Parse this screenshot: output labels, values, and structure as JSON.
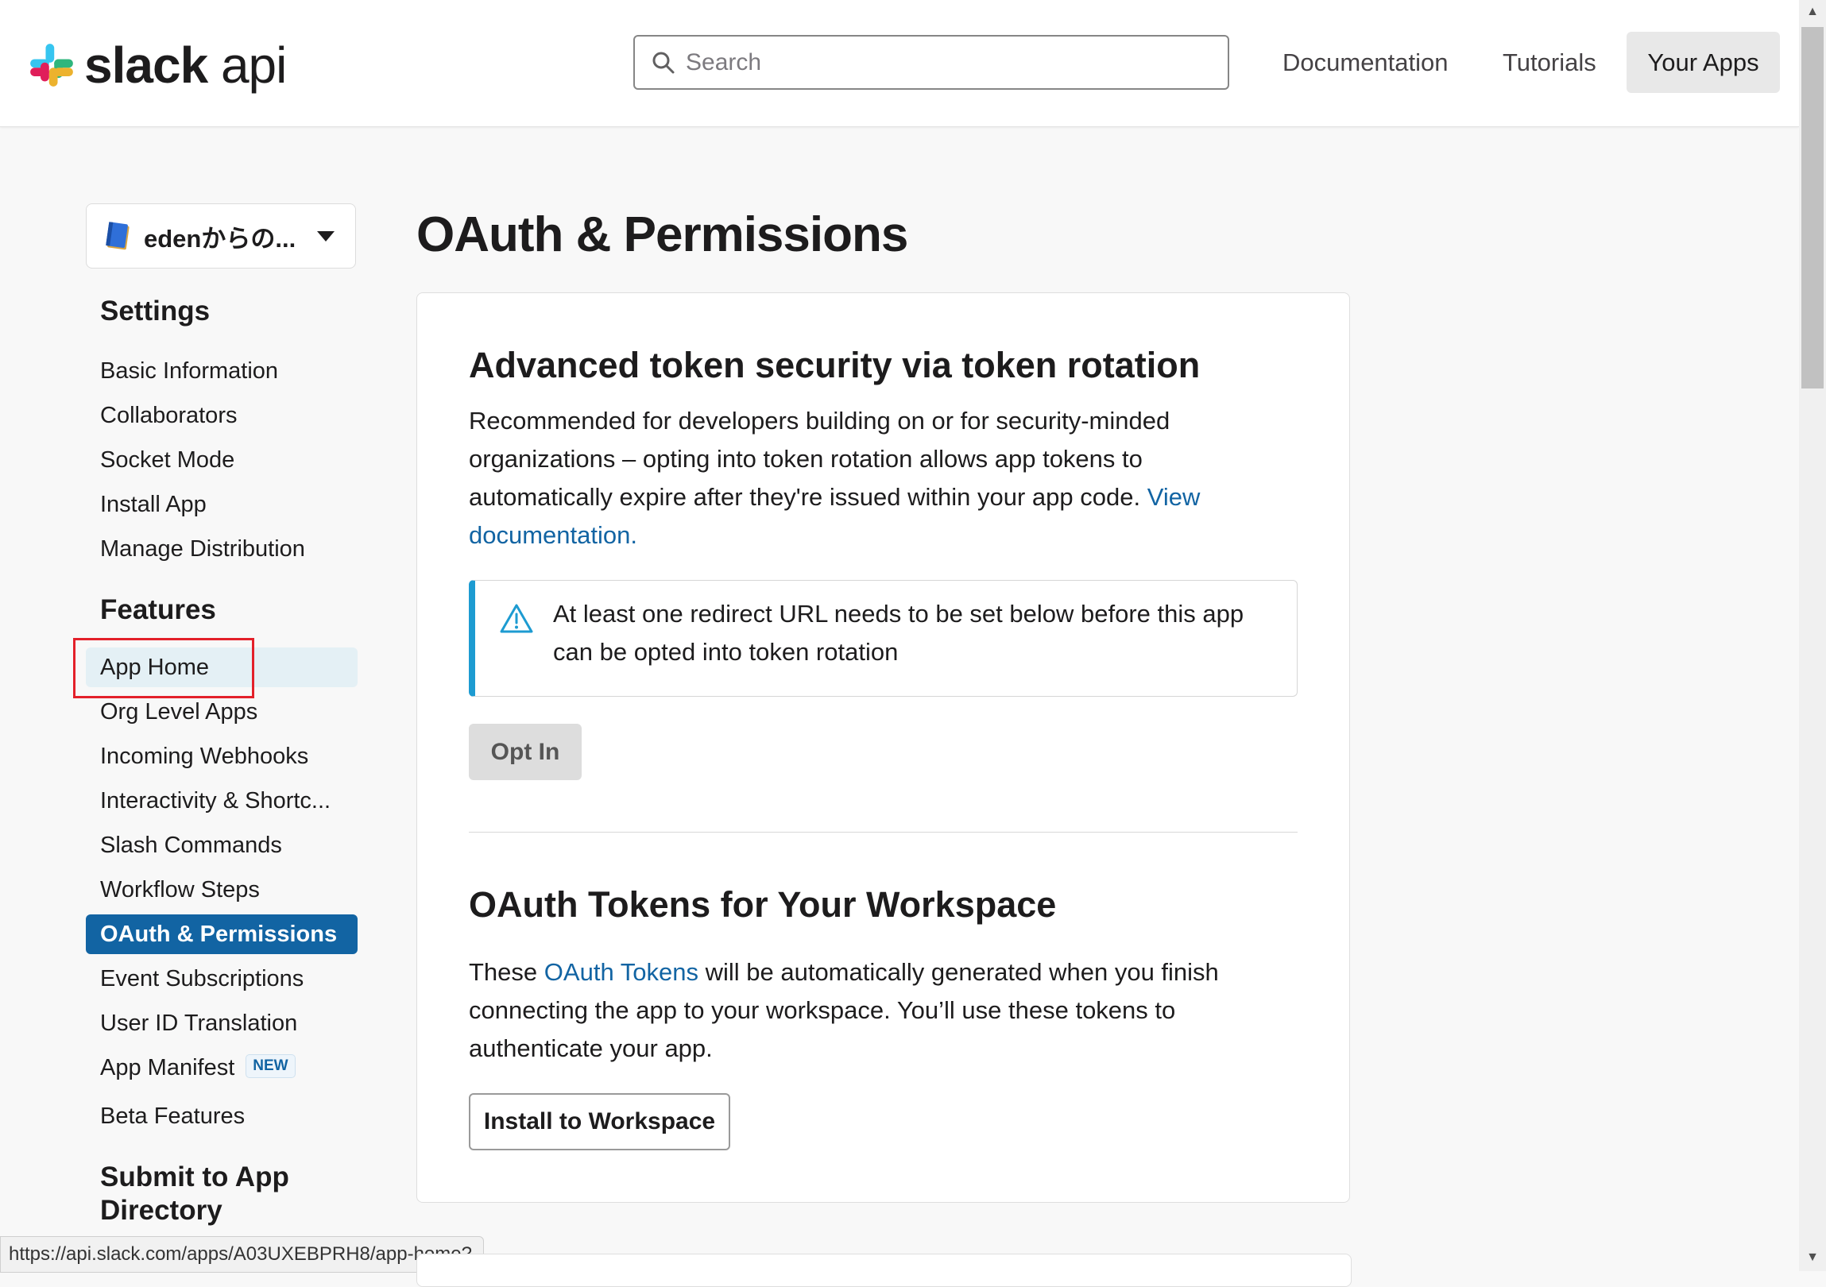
{
  "header": {
    "logo_bold": "slack",
    "logo_light": "api",
    "search_placeholder": "Search",
    "nav": [
      "Documentation",
      "Tutorials",
      "Your Apps"
    ]
  },
  "sidebar": {
    "app_name": "edenからの...",
    "settings_title": "Settings",
    "settings_items": [
      "Basic Information",
      "Collaborators",
      "Socket Mode",
      "Install App",
      "Manage Distribution"
    ],
    "features_title": "Features",
    "features_items": [
      "App Home",
      "Org Level Apps",
      "Incoming Webhooks",
      "Interactivity & Shortc...",
      "Slash Commands",
      "Workflow Steps",
      "OAuth & Permissions",
      "Event Subscriptions",
      "User ID Translation",
      "App Manifest",
      "Beta Features"
    ],
    "new_badge": "NEW",
    "submit_title_line1": "Submit to App",
    "submit_title_line2": "Directory",
    "status_url": "https://api.slack.com/apps/A03UXEBPRH8/app-home?"
  },
  "main": {
    "page_title": "OAuth & Permissions",
    "token_rotation": {
      "title": "Advanced token security via token rotation",
      "description": "Recommended for developers building on or for security-minded organizations – opting into token rotation allows app tokens to automatically expire after they're issued within your app code.",
      "link": "View documentation.",
      "alert": "At least one redirect URL needs to be set below before this app can be opted into token rotation",
      "button": "Opt In"
    },
    "oauth_tokens": {
      "title": "OAuth Tokens for Your Workspace",
      "text_before": "These",
      "link": "OAuth Tokens",
      "text_after": "will be automatically generated when you finish connecting the app to your workspace. You’ll use these tokens to authenticate your app.",
      "button": "Install to Workspace"
    }
  },
  "colors": {
    "accent": "#1264a3",
    "alert_border": "#1d9bd1",
    "highlight": "#e3202a"
  }
}
